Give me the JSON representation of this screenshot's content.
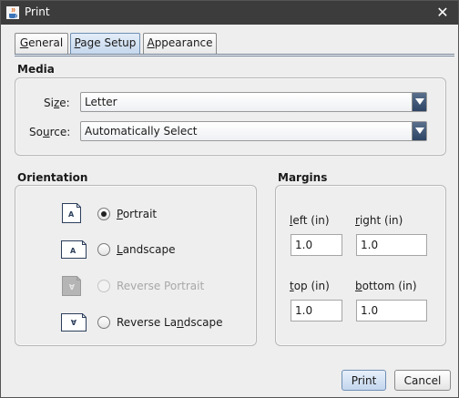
{
  "window": {
    "title": "Print",
    "close_glyph": "✕",
    "app_icon": "java-cup-icon"
  },
  "tabs": [
    {
      "label": "General",
      "mnemonic_index": 0,
      "active": false
    },
    {
      "label": "Page Setup",
      "mnemonic_index": 0,
      "active": true
    },
    {
      "label": "Appearance",
      "mnemonic_index": 0,
      "active": false
    }
  ],
  "media": {
    "title": "Media",
    "size_label": "Size:",
    "size_value": "Letter",
    "source_label": "Source:",
    "source_value": "Automatically Select"
  },
  "orientation": {
    "title": "Orientation",
    "options": [
      {
        "label": "Portrait",
        "selected": true,
        "enabled": true,
        "icon": "portrait-page-icon"
      },
      {
        "label": "Landscape",
        "selected": false,
        "enabled": true,
        "icon": "landscape-page-icon"
      },
      {
        "label": "Reverse Portrait",
        "selected": false,
        "enabled": false,
        "icon": "reverse-portrait-page-icon"
      },
      {
        "label": "Reverse Landscape",
        "selected": false,
        "enabled": true,
        "icon": "reverse-landscape-page-icon"
      }
    ]
  },
  "margins": {
    "title": "Margins",
    "left_label": "left (in)",
    "left_value": "1.0",
    "right_label": "right (in)",
    "right_value": "1.0",
    "top_label": "top (in)",
    "top_value": "1.0",
    "bottom_label": "bottom (in)",
    "bottom_value": "1.0"
  },
  "buttons": {
    "print": "Print",
    "cancel": "Cancel"
  },
  "colors": {
    "titlebar": "#3c3c3c",
    "dialog_bg": "#eeeeee",
    "active_tab": "#c6d8ee",
    "combo_arrow": "#2e4465"
  }
}
